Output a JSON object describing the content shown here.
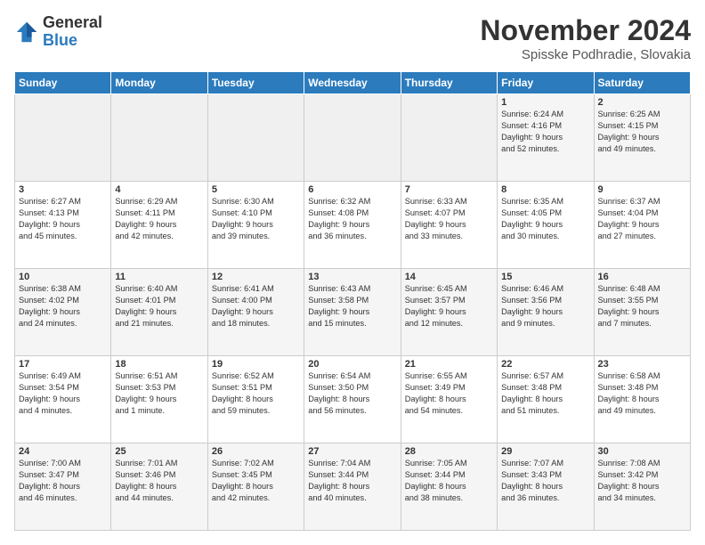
{
  "logo": {
    "general": "General",
    "blue": "Blue"
  },
  "title": "November 2024",
  "subtitle": "Spisske Podhradie, Slovakia",
  "headers": [
    "Sunday",
    "Monday",
    "Tuesday",
    "Wednesday",
    "Thursday",
    "Friday",
    "Saturday"
  ],
  "weeks": [
    [
      {
        "day": "",
        "info": ""
      },
      {
        "day": "",
        "info": ""
      },
      {
        "day": "",
        "info": ""
      },
      {
        "day": "",
        "info": ""
      },
      {
        "day": "",
        "info": ""
      },
      {
        "day": "1",
        "info": "Sunrise: 6:24 AM\nSunset: 4:16 PM\nDaylight: 9 hours\nand 52 minutes."
      },
      {
        "day": "2",
        "info": "Sunrise: 6:25 AM\nSunset: 4:15 PM\nDaylight: 9 hours\nand 49 minutes."
      }
    ],
    [
      {
        "day": "3",
        "info": "Sunrise: 6:27 AM\nSunset: 4:13 PM\nDaylight: 9 hours\nand 45 minutes."
      },
      {
        "day": "4",
        "info": "Sunrise: 6:29 AM\nSunset: 4:11 PM\nDaylight: 9 hours\nand 42 minutes."
      },
      {
        "day": "5",
        "info": "Sunrise: 6:30 AM\nSunset: 4:10 PM\nDaylight: 9 hours\nand 39 minutes."
      },
      {
        "day": "6",
        "info": "Sunrise: 6:32 AM\nSunset: 4:08 PM\nDaylight: 9 hours\nand 36 minutes."
      },
      {
        "day": "7",
        "info": "Sunrise: 6:33 AM\nSunset: 4:07 PM\nDaylight: 9 hours\nand 33 minutes."
      },
      {
        "day": "8",
        "info": "Sunrise: 6:35 AM\nSunset: 4:05 PM\nDaylight: 9 hours\nand 30 minutes."
      },
      {
        "day": "9",
        "info": "Sunrise: 6:37 AM\nSunset: 4:04 PM\nDaylight: 9 hours\nand 27 minutes."
      }
    ],
    [
      {
        "day": "10",
        "info": "Sunrise: 6:38 AM\nSunset: 4:02 PM\nDaylight: 9 hours\nand 24 minutes."
      },
      {
        "day": "11",
        "info": "Sunrise: 6:40 AM\nSunset: 4:01 PM\nDaylight: 9 hours\nand 21 minutes."
      },
      {
        "day": "12",
        "info": "Sunrise: 6:41 AM\nSunset: 4:00 PM\nDaylight: 9 hours\nand 18 minutes."
      },
      {
        "day": "13",
        "info": "Sunrise: 6:43 AM\nSunset: 3:58 PM\nDaylight: 9 hours\nand 15 minutes."
      },
      {
        "day": "14",
        "info": "Sunrise: 6:45 AM\nSunset: 3:57 PM\nDaylight: 9 hours\nand 12 minutes."
      },
      {
        "day": "15",
        "info": "Sunrise: 6:46 AM\nSunset: 3:56 PM\nDaylight: 9 hours\nand 9 minutes."
      },
      {
        "day": "16",
        "info": "Sunrise: 6:48 AM\nSunset: 3:55 PM\nDaylight: 9 hours\nand 7 minutes."
      }
    ],
    [
      {
        "day": "17",
        "info": "Sunrise: 6:49 AM\nSunset: 3:54 PM\nDaylight: 9 hours\nand 4 minutes."
      },
      {
        "day": "18",
        "info": "Sunrise: 6:51 AM\nSunset: 3:53 PM\nDaylight: 9 hours\nand 1 minute."
      },
      {
        "day": "19",
        "info": "Sunrise: 6:52 AM\nSunset: 3:51 PM\nDaylight: 8 hours\nand 59 minutes."
      },
      {
        "day": "20",
        "info": "Sunrise: 6:54 AM\nSunset: 3:50 PM\nDaylight: 8 hours\nand 56 minutes."
      },
      {
        "day": "21",
        "info": "Sunrise: 6:55 AM\nSunset: 3:49 PM\nDaylight: 8 hours\nand 54 minutes."
      },
      {
        "day": "22",
        "info": "Sunrise: 6:57 AM\nSunset: 3:48 PM\nDaylight: 8 hours\nand 51 minutes."
      },
      {
        "day": "23",
        "info": "Sunrise: 6:58 AM\nSunset: 3:48 PM\nDaylight: 8 hours\nand 49 minutes."
      }
    ],
    [
      {
        "day": "24",
        "info": "Sunrise: 7:00 AM\nSunset: 3:47 PM\nDaylight: 8 hours\nand 46 minutes."
      },
      {
        "day": "25",
        "info": "Sunrise: 7:01 AM\nSunset: 3:46 PM\nDaylight: 8 hours\nand 44 minutes."
      },
      {
        "day": "26",
        "info": "Sunrise: 7:02 AM\nSunset: 3:45 PM\nDaylight: 8 hours\nand 42 minutes."
      },
      {
        "day": "27",
        "info": "Sunrise: 7:04 AM\nSunset: 3:44 PM\nDaylight: 8 hours\nand 40 minutes."
      },
      {
        "day": "28",
        "info": "Sunrise: 7:05 AM\nSunset: 3:44 PM\nDaylight: 8 hours\nand 38 minutes."
      },
      {
        "day": "29",
        "info": "Sunrise: 7:07 AM\nSunset: 3:43 PM\nDaylight: 8 hours\nand 36 minutes."
      },
      {
        "day": "30",
        "info": "Sunrise: 7:08 AM\nSunset: 3:42 PM\nDaylight: 8 hours\nand 34 minutes."
      }
    ]
  ]
}
